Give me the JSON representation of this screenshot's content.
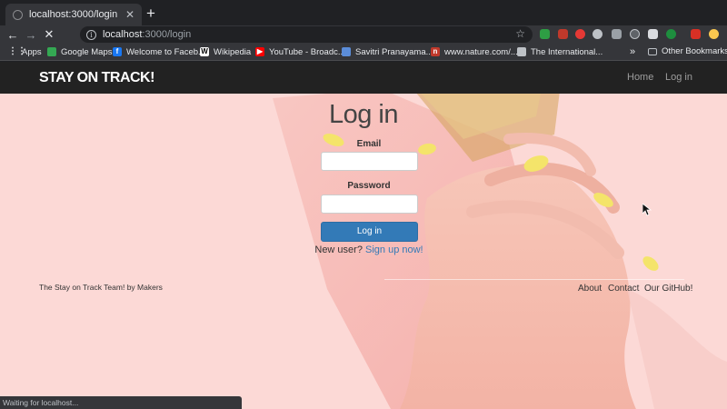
{
  "browser": {
    "tab_title": "localhost:3000/login",
    "url_host": "localhost",
    "url_rest": ":3000/login",
    "status_text": "Waiting for localhost..."
  },
  "bookmarks": {
    "items": [
      {
        "label": "Apps",
        "icon": "apps-grid-icon"
      },
      {
        "label": "Google Maps",
        "icon": "maps-icon"
      },
      {
        "label": "Welcome to Faceb...",
        "icon": "facebook-icon"
      },
      {
        "label": "Wikipedia",
        "icon": "wikipedia-icon"
      },
      {
        "label": "YouTube - Broadc...",
        "icon": "youtube-icon"
      },
      {
        "label": "Savitri Pranayama...",
        "icon": "site-icon"
      },
      {
        "label": "www.nature.com/...",
        "icon": "nature-icon"
      },
      {
        "label": "The International...",
        "icon": "site-icon"
      }
    ],
    "more": "»",
    "other": "Other Bookmarks"
  },
  "site": {
    "brand": "STAY ON TRACK!",
    "nav": {
      "home": "Home",
      "login": "Log in"
    }
  },
  "login": {
    "title": "Log in",
    "email_label": "Email",
    "email_value": "",
    "password_label": "Password",
    "password_value": "",
    "submit_label": "Log in",
    "new_user_text": "New user?",
    "signup_link": "Sign up now!"
  },
  "footer": {
    "team": "The Stay on Track Team! by Makers",
    "links": {
      "about": "About",
      "contact": "Contact",
      "github": "Our GitHub!"
    }
  },
  "colors": {
    "page_bg": "#fcd9d6",
    "navbar": "#222222",
    "primary_button": "#337ab7",
    "link": "#337ab7"
  }
}
